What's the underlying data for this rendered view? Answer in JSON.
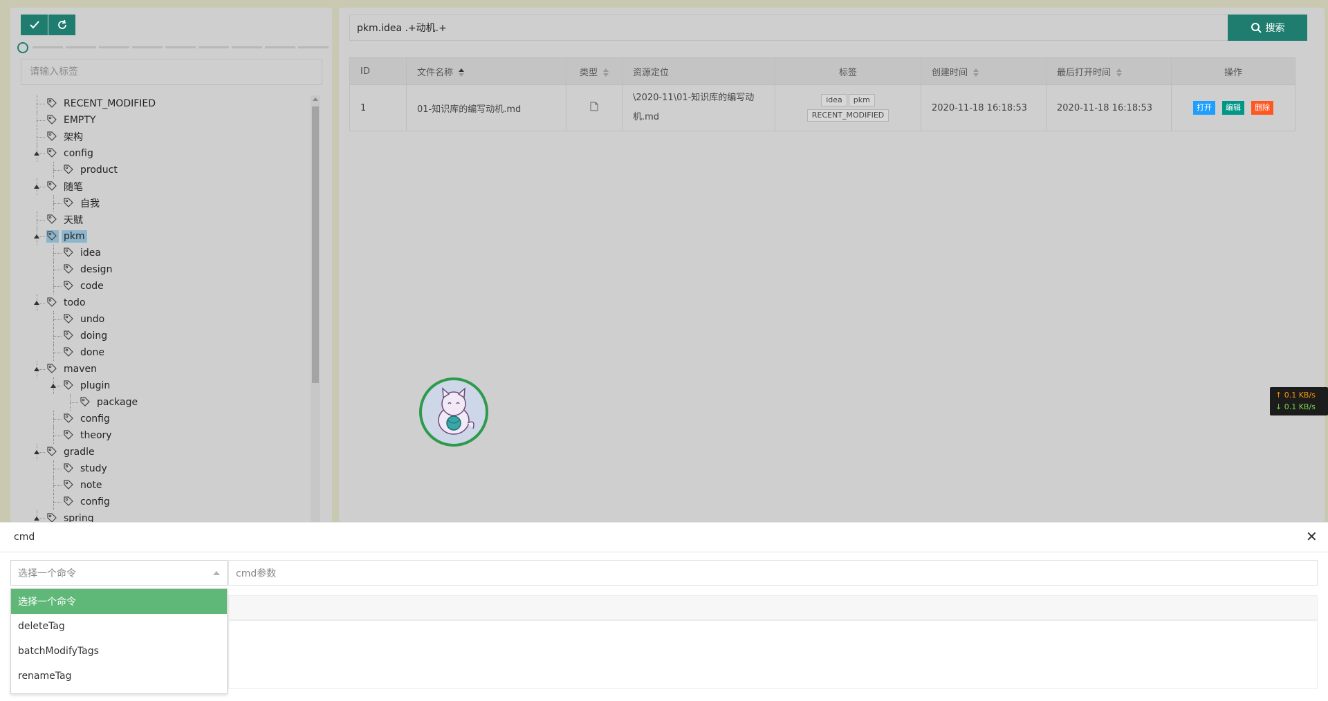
{
  "left": {
    "toolbar": {
      "confirm_icon": "check-icon",
      "refresh_icon": "refresh-icon"
    },
    "tag_input": {
      "placeholder": "请输入标签"
    },
    "tree": [
      {
        "label": "RECENT_MODIFIED",
        "level": 0
      },
      {
        "label": "EMPTY",
        "level": 0
      },
      {
        "label": "架构",
        "level": 0
      },
      {
        "label": "config",
        "level": 0,
        "expanded": true
      },
      {
        "label": "product",
        "level": 1
      },
      {
        "label": "随笔",
        "level": 0,
        "expanded": true
      },
      {
        "label": "自我",
        "level": 1
      },
      {
        "label": "天赋",
        "level": 0
      },
      {
        "label": "pkm",
        "level": 0,
        "expanded": true,
        "selected": true
      },
      {
        "label": "idea",
        "level": 1
      },
      {
        "label": "design",
        "level": 1
      },
      {
        "label": "code",
        "level": 1
      },
      {
        "label": "todo",
        "level": 0,
        "expanded": true
      },
      {
        "label": "undo",
        "level": 1
      },
      {
        "label": "doing",
        "level": 1
      },
      {
        "label": "done",
        "level": 1
      },
      {
        "label": "maven",
        "level": 0,
        "expanded": true
      },
      {
        "label": "plugin",
        "level": 1,
        "expanded": true
      },
      {
        "label": "package",
        "level": 2
      },
      {
        "label": "config",
        "level": 1
      },
      {
        "label": "theory",
        "level": 1
      },
      {
        "label": "gradle",
        "level": 0,
        "expanded": true
      },
      {
        "label": "study",
        "level": 1
      },
      {
        "label": "note",
        "level": 1
      },
      {
        "label": "config",
        "level": 1
      },
      {
        "label": "spring",
        "level": 0,
        "expanded": true
      }
    ]
  },
  "search": {
    "query": "pkm.idea .+动机.+",
    "button_label": "搜索"
  },
  "table": {
    "headers": [
      "ID",
      "文件名称",
      "类型",
      "资源定位",
      "标签",
      "创建时间",
      "最后打开时间",
      "操作"
    ],
    "rows": [
      {
        "id": "1",
        "name": "01-知识库的编写动机.md",
        "type_icon": "file-icon",
        "path_line1": "\\2020-11\\01-知识库的编写动",
        "path_line2": "机.md",
        "tags": [
          "idea",
          "pkm",
          "RECENT_MODIFIED"
        ],
        "created": "2020-11-18 16:18:53",
        "last_opened": "2020-11-18 16:18:53",
        "actions": {
          "open": "打开",
          "edit": "编辑",
          "delete": "删除"
        }
      }
    ]
  },
  "net": {
    "up": "↑ 0.1 KB/s",
    "down": "↓ 0.1 KB/s"
  },
  "drawer": {
    "title": "cmd",
    "select_placeholder": "选择一个命令",
    "param_placeholder": "cmd参数",
    "options": [
      "选择一个命令",
      "deleteTag",
      "batchModifyTags",
      "renameTag"
    ]
  },
  "colors": {
    "accent": "#1e7d6e",
    "open": "#1e9fff",
    "edit": "#009688",
    "delete": "#ff5722",
    "selected_option": "#5fb878"
  }
}
